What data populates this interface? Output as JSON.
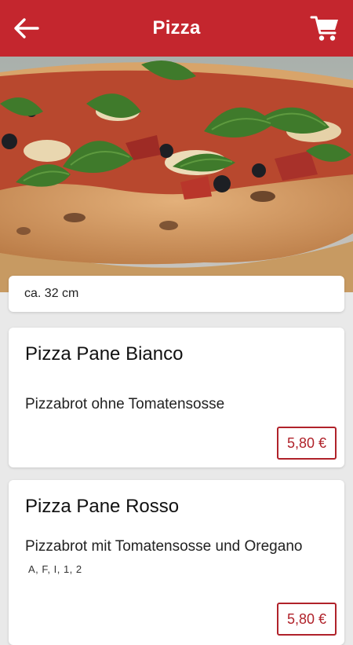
{
  "header": {
    "title": "Pizza",
    "back_icon": "arrow-left-icon",
    "cart_icon": "shopping-cart-icon",
    "background_color": "#c4262e"
  },
  "hero": {
    "image": "pizza-photo",
    "size_text": "ca. 32 cm"
  },
  "products": [
    {
      "name": "Pizza Pane Bianco",
      "description": "Pizzabrot ohne Tomatensosse",
      "allergens": "",
      "price": "5,80 €"
    },
    {
      "name": "Pizza Pane Rosso",
      "description": "Pizzabrot mit Tomatensosse und Oregano",
      "allergens": "A, F, I, 1, 2",
      "price": "5,80 €"
    }
  ],
  "colors": {
    "accent": "#c4262e",
    "price": "#b0222a",
    "background": "#e9e9e9"
  }
}
